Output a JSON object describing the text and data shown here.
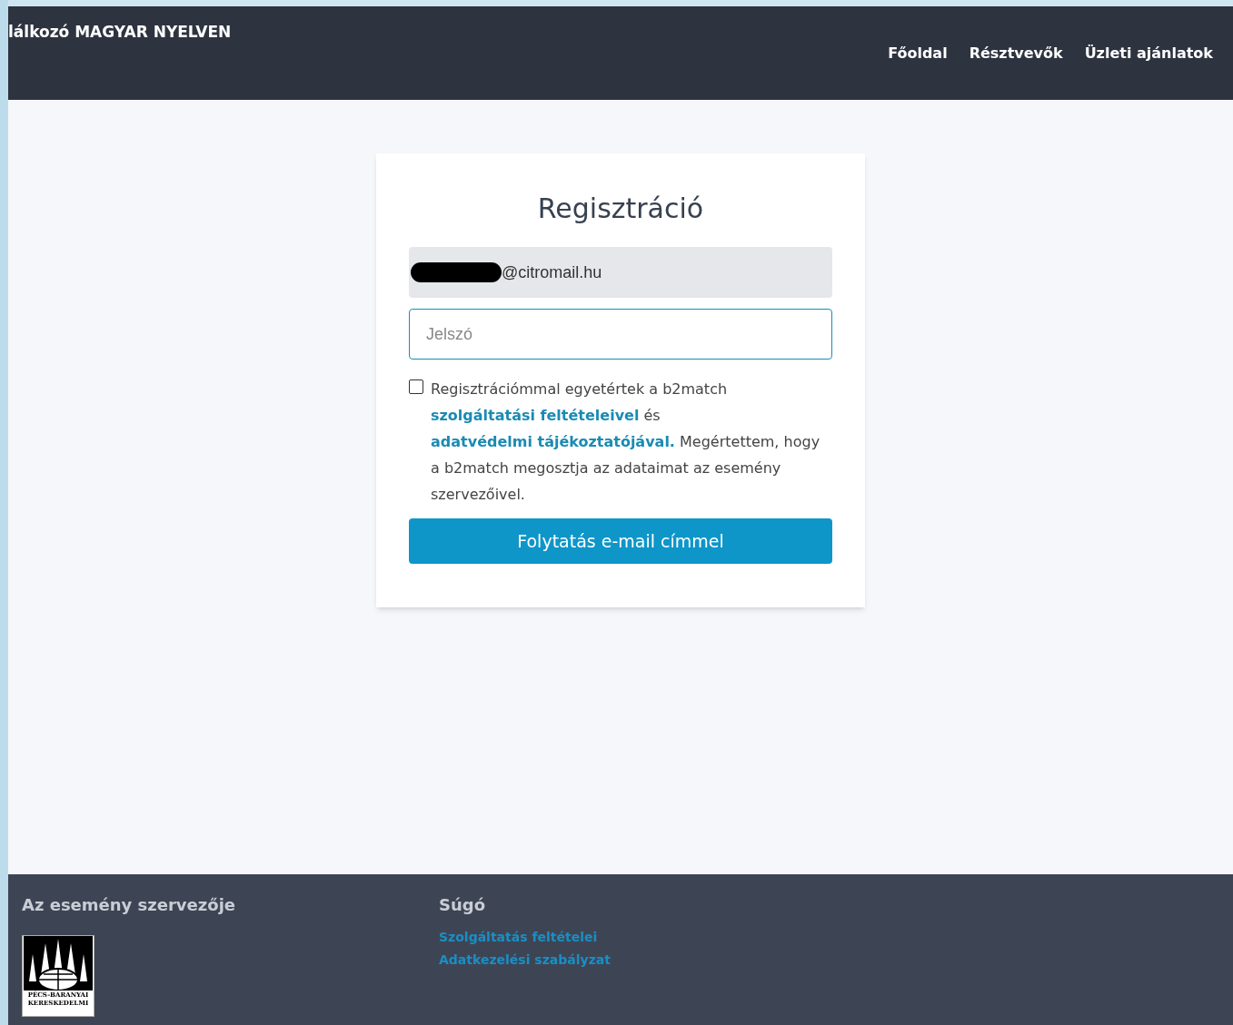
{
  "header": {
    "title": "lálkozó MAGYAR NYELVEN",
    "nav": [
      {
        "label": "Főoldal"
      },
      {
        "label": "Résztvevők"
      },
      {
        "label": "Üzleti ajánlatok"
      }
    ]
  },
  "card": {
    "title": "Regisztráció",
    "email": {
      "value": "@citromail.hu",
      "redacted": true
    },
    "password": {
      "placeholder": "Jelszó"
    },
    "consent": {
      "checked": false,
      "segments": [
        {
          "kind": "text",
          "text": "Regisztrációmmal egyetértek a b2match"
        },
        {
          "kind": "link",
          "text": "szolgáltatási feltételeivel"
        },
        {
          "kind": "text",
          "text": "és"
        },
        {
          "kind": "link",
          "text": "adatvédelmi tájékoztatójával."
        },
        {
          "kind": "text",
          "text": "Megértettem, hogy a b2match megosztja az adataimat az esemény szervezőivel."
        }
      ]
    },
    "button": "Folytatás e-mail címmel"
  },
  "footer": {
    "organizer": {
      "heading": "Az esemény szervezője",
      "logo_lines": [
        "PÉCS-BARANYAI",
        "KERESKEDELMI"
      ]
    },
    "help": {
      "heading": "Súgó",
      "links": [
        "Szolgáltatás feltételei",
        "Adatkezelési szabályzat"
      ]
    }
  }
}
